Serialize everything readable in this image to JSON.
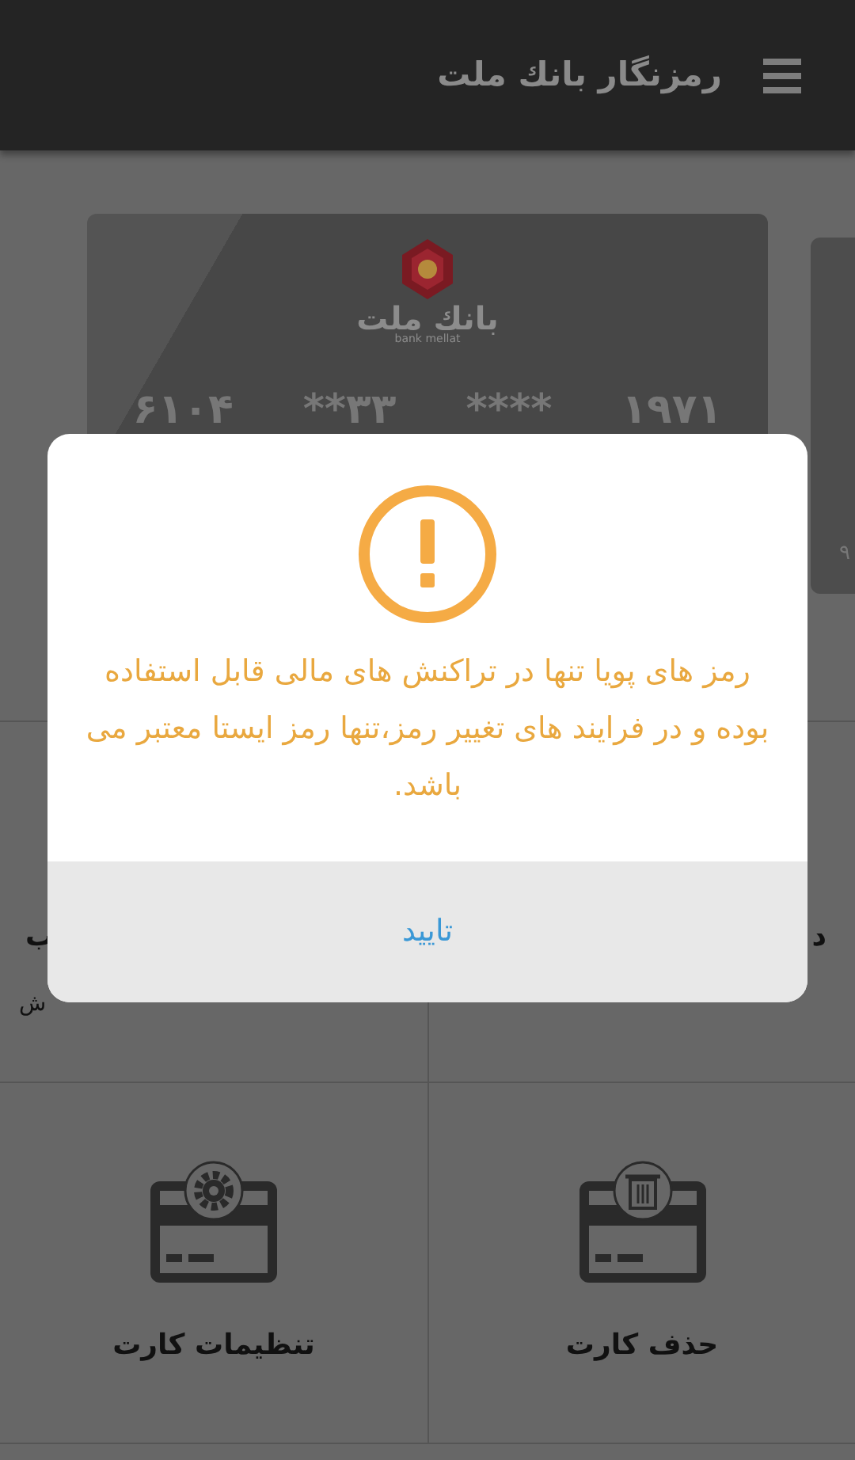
{
  "app_bar": {
    "title": "رمزنگار بانك ملت"
  },
  "card": {
    "bank_name": "بانك ملت",
    "bank_name_latin": "bank mellat",
    "number_groups": [
      "۱۹۷۱",
      "****",
      "۳۳**",
      "۶۱۰۴"
    ]
  },
  "next_card": {
    "number_fragment": "۹"
  },
  "actions": [
    {
      "kind": "none",
      "label": "د"
    },
    {
      "kind": "none",
      "label": "ب",
      "detail": "ش"
    },
    {
      "kind": "delete",
      "label": "حذف کارت"
    },
    {
      "kind": "settings",
      "label": "تنظیمات کارت"
    }
  ],
  "dialog": {
    "kind": "warning",
    "message": "رمز های پویا تنها در تراکنش های مالی قابل استفاده بوده و در فرایند های تغییر رمز،تنها رمز ایستا معتبر می باشد.",
    "button": "تایید"
  }
}
